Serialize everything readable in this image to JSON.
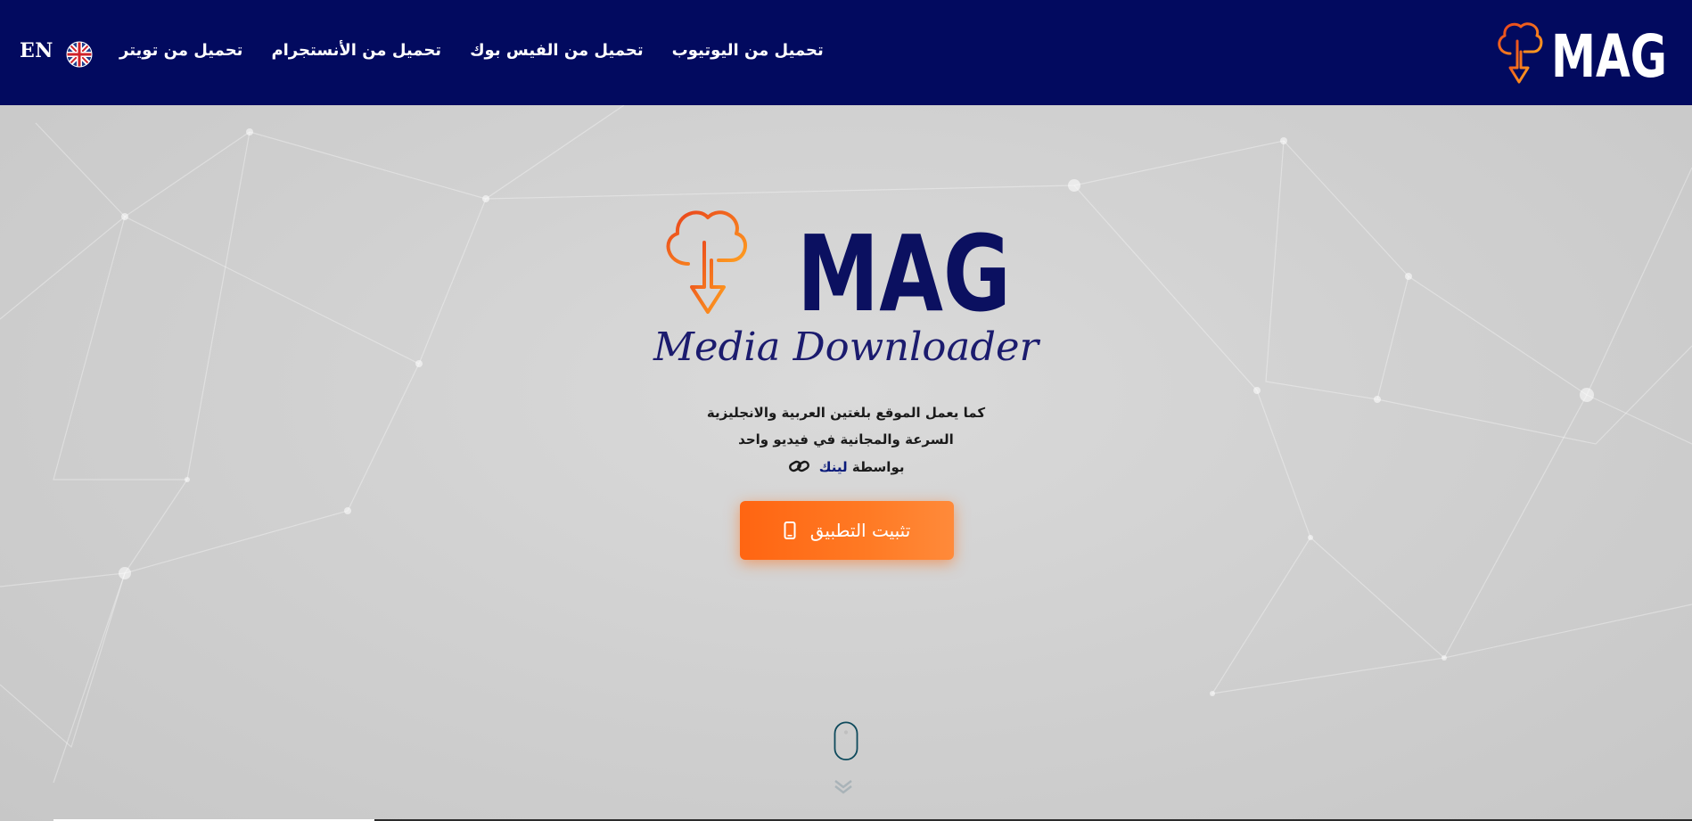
{
  "header": {
    "lang_label": "EN",
    "flag_icon": "uk-flag-icon",
    "nav": [
      {
        "label": "تحميل من تويتر"
      },
      {
        "label": "تحميل من الأنستجرام"
      },
      {
        "label": "تحميل من الفيس بوك"
      },
      {
        "label": "تحميل من اليوتيوب"
      }
    ],
    "logo_text": "MAG"
  },
  "hero": {
    "logo_text": "MAG",
    "logo_subtitle": "Media Downloader",
    "tagline_line1": "كما يعمل الموقع بلغتين العربية والانجليزية",
    "tagline_line2": "السرعة والمجانية في فيديو واحد",
    "tagline_line3_prefix": "بواسطة",
    "tagline_line3_link": "لينك",
    "install_button_label": "تثبيت التطبيق",
    "install_icon": "mobile-phone-icon",
    "scroll_icon": "mouse-scroll-icon"
  },
  "colors": {
    "header_bg": "#020a5f",
    "brand_navy": "#0b1060",
    "accent_orange": "#ff6b18",
    "hero_bg": "#cfcfcf"
  }
}
